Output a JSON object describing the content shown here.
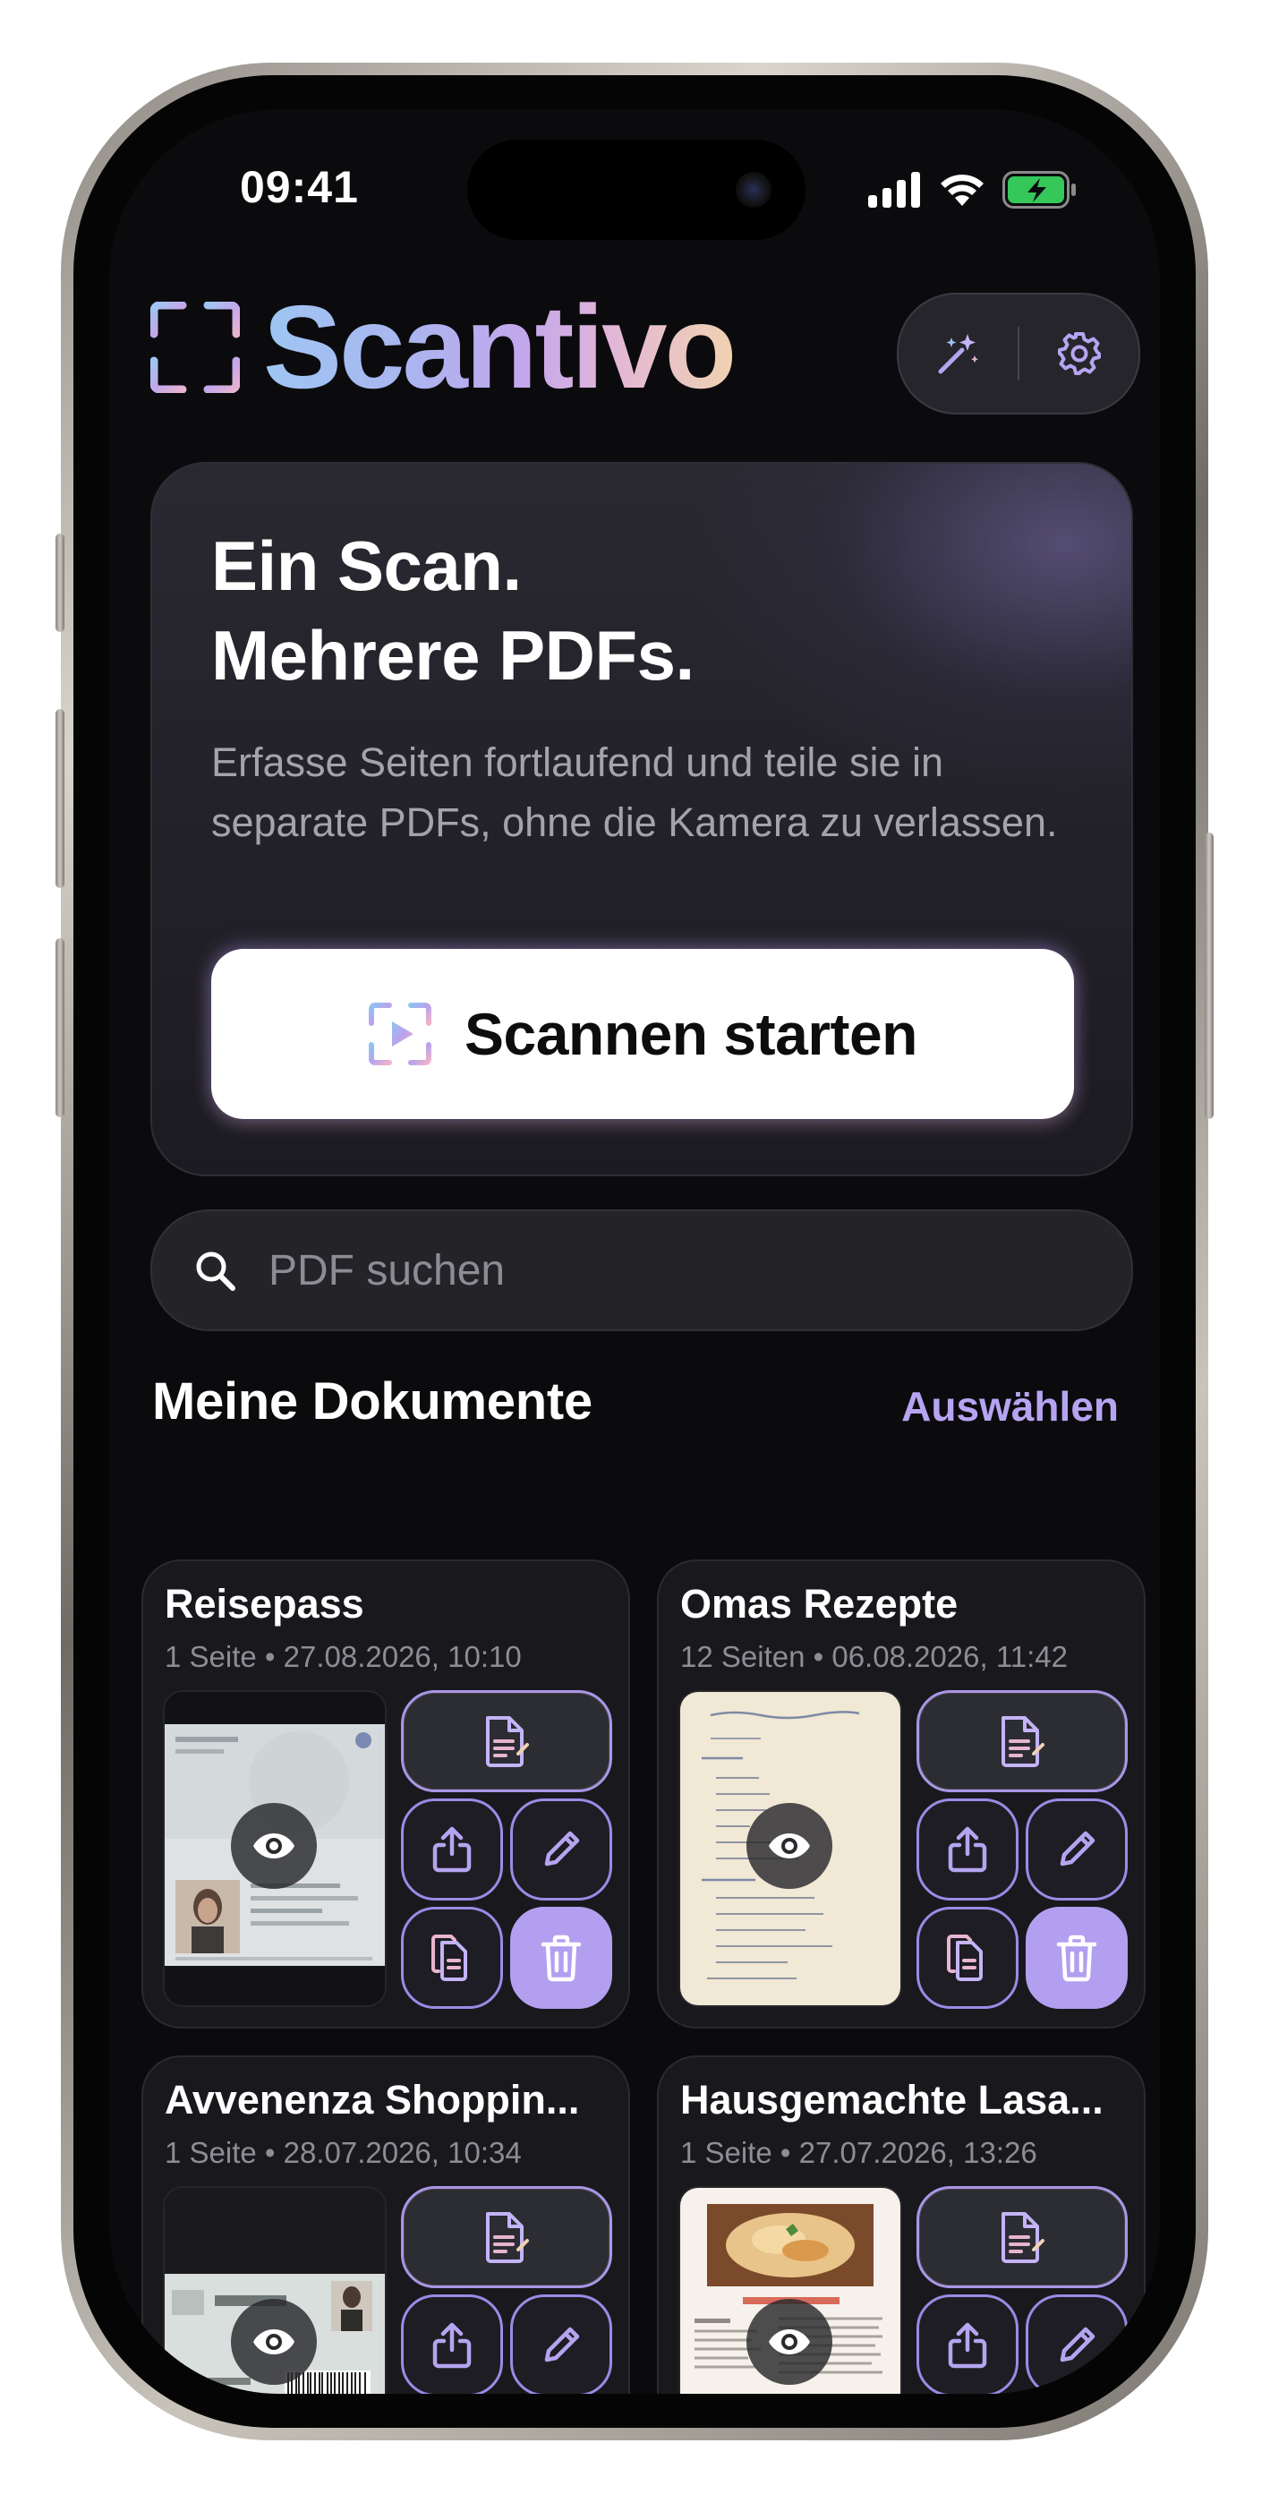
{
  "status_bar": {
    "time": "09:41"
  },
  "app": {
    "name": "Scantivo"
  },
  "hero": {
    "title_line1": "Ein Scan.",
    "title_line2": "Mehrere PDFs.",
    "description": "Erfasse Seiten fortlaufend und teile sie in separate PDFs, ohne die Kamera zu verlassen.",
    "button_label": "Scannen starten"
  },
  "search": {
    "placeholder": "PDF suchen",
    "value": ""
  },
  "documents": {
    "title": "Meine Dokumente",
    "select_label": "Auswählen",
    "items": [
      {
        "title": "Reisepass",
        "meta": "1 Seite • 27.08.2026, 10:10"
      },
      {
        "title": "Omas Rezepte",
        "meta": "12 Seiten • 06.08.2026, 11:42"
      },
      {
        "title": "Avvenenza Shoppin...",
        "meta": "1 Seite • 28.07.2026, 10:34"
      },
      {
        "title": "Hausgemachte Lasa...",
        "meta": "1 Seite • 27.07.2026, 13:26"
      }
    ]
  },
  "colors": {
    "accent": "#b39ff0",
    "background": "#0b0b0e",
    "card": "#19191d"
  },
  "icons": [
    "sparkle-wand-icon",
    "gear-icon",
    "scan-play-icon",
    "search-icon",
    "eye-icon",
    "pdf-icon",
    "share-icon",
    "pencil-icon",
    "copy-icon",
    "trash-icon"
  ]
}
